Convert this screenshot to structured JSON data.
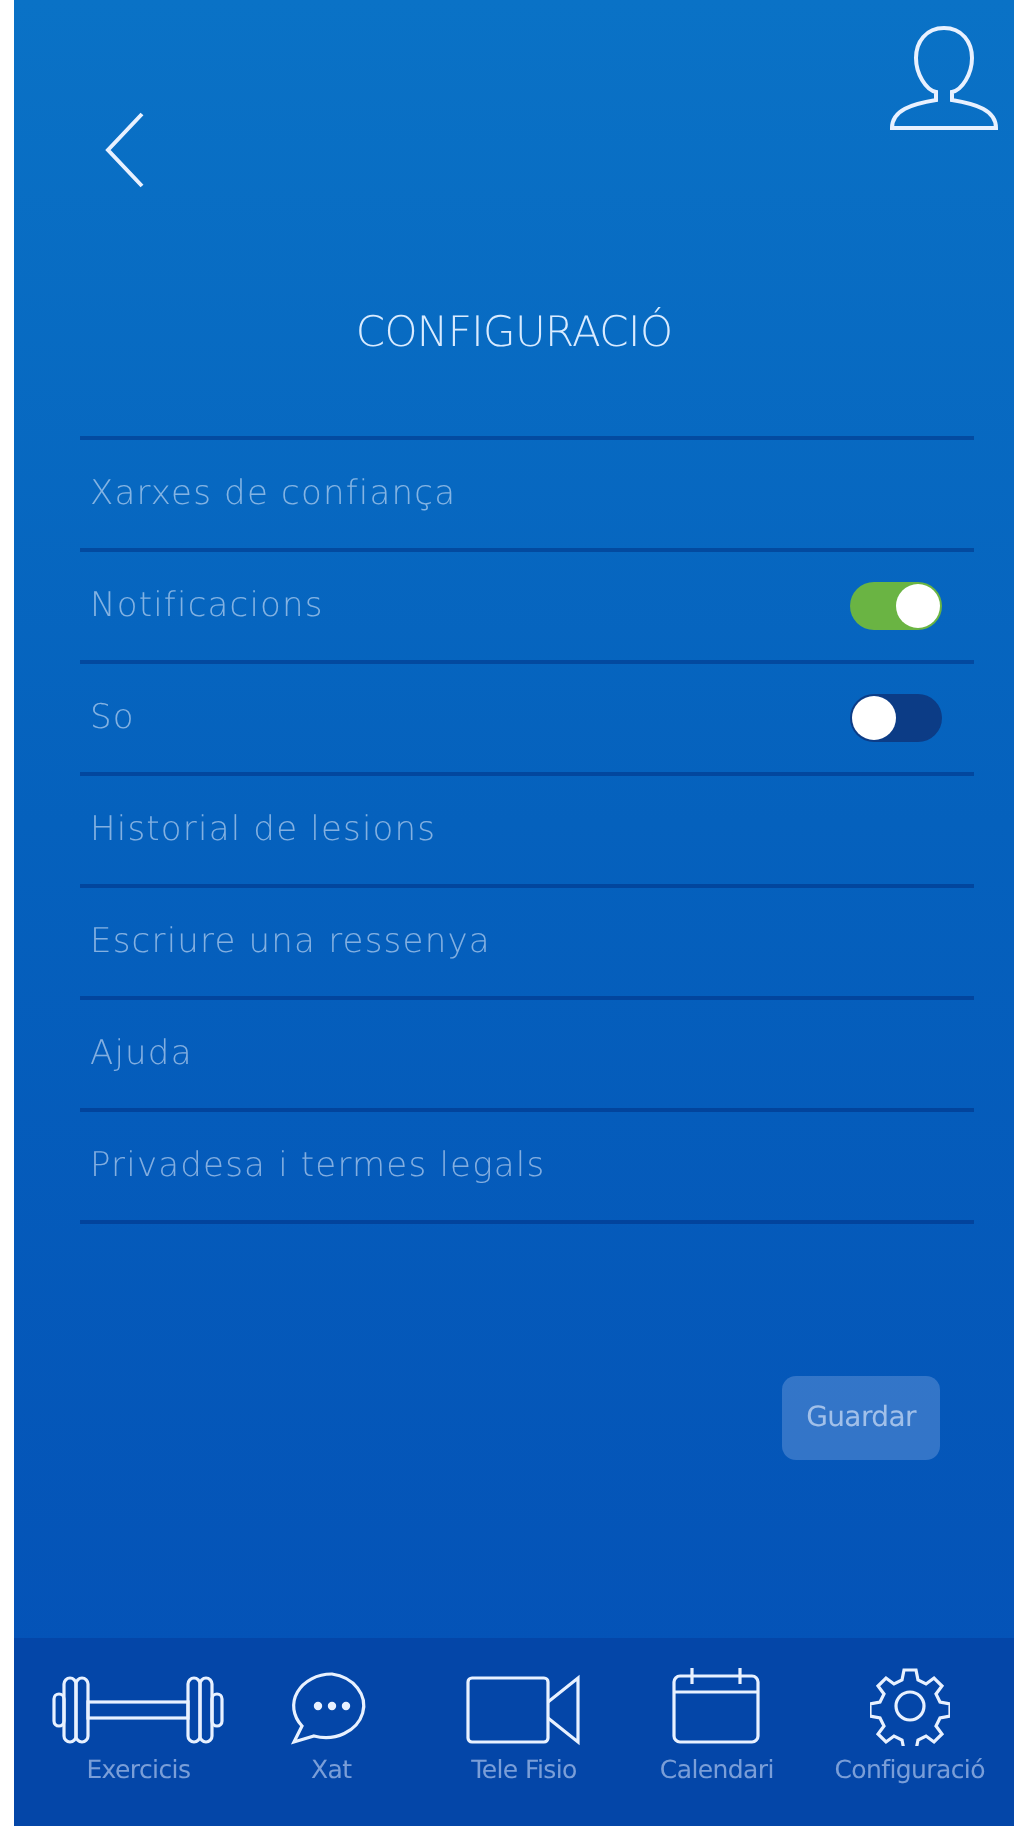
{
  "header": {
    "title": "CONFIGURACIÓ"
  },
  "settings": [
    {
      "kind": "link",
      "label": "Xarxes de confiança"
    },
    {
      "kind": "toggle",
      "label": "Notificacions",
      "on": true
    },
    {
      "kind": "toggle",
      "label": "So",
      "on": false
    },
    {
      "kind": "link",
      "label": "Historial de lesions"
    },
    {
      "kind": "link",
      "label": "Escriure una ressenya"
    },
    {
      "kind": "link",
      "label": "Ajuda"
    },
    {
      "kind": "link",
      "label": "Privadesa i termes legals"
    }
  ],
  "save_button": {
    "label": "Guardar",
    "disabled": true
  },
  "tab_bar": [
    {
      "kind": "dumbbell",
      "label": "Exercicis"
    },
    {
      "kind": "chat",
      "label": "Xat"
    },
    {
      "kind": "video",
      "label": "Tele Fisio"
    },
    {
      "kind": "calendar",
      "label": "Calendari"
    },
    {
      "kind": "gear",
      "label": "Configuració"
    }
  ]
}
